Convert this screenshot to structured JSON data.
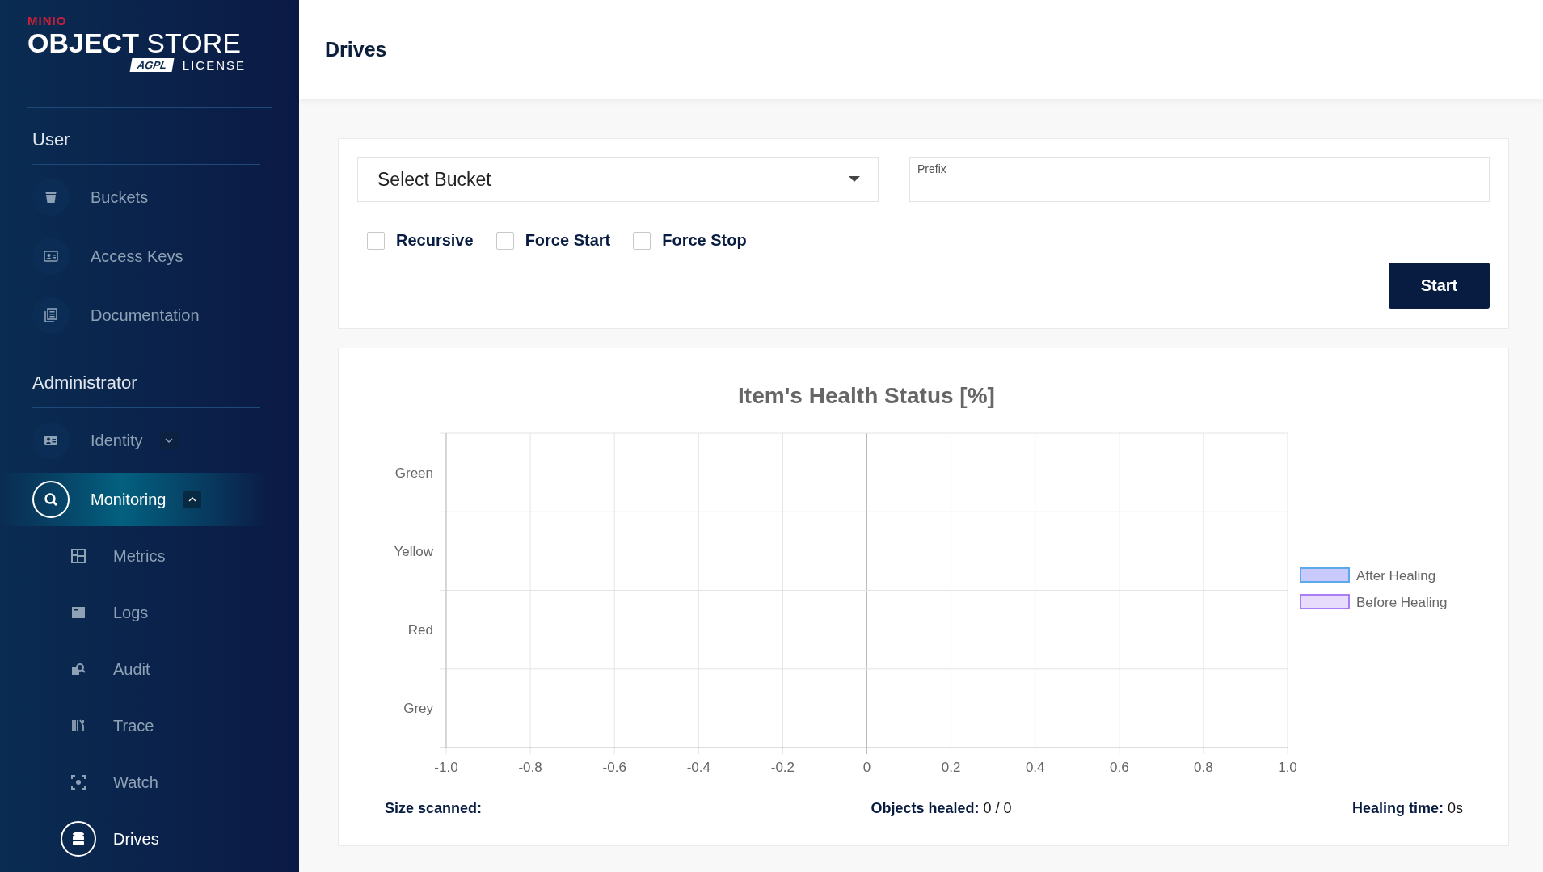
{
  "sidebar": {
    "logo": {
      "brand": "MINIO",
      "product_bold": "OBJECT",
      "product_light": "STORE",
      "badge": "AGPL",
      "license": "LICENSE"
    },
    "sections": [
      {
        "title": "User",
        "items": [
          {
            "label": "Buckets",
            "selected": false
          },
          {
            "label": "Access Keys",
            "selected": false
          },
          {
            "label": "Documentation",
            "selected": false
          }
        ]
      },
      {
        "title": "Administrator",
        "items": [
          {
            "label": "Identity",
            "selected": false,
            "expanded": false
          },
          {
            "label": "Monitoring",
            "selected": true,
            "expanded": true,
            "children": [
              {
                "label": "Metrics",
                "selected": false
              },
              {
                "label": "Logs",
                "selected": false
              },
              {
                "label": "Audit",
                "selected": false
              },
              {
                "label": "Trace",
                "selected": false
              },
              {
                "label": "Watch",
                "selected": false
              },
              {
                "label": "Drives",
                "selected": true
              }
            ]
          }
        ]
      }
    ]
  },
  "header": {
    "title": "Drives"
  },
  "form": {
    "bucket_select": {
      "value": "Select Bucket"
    },
    "prefix": {
      "label": "Prefix"
    },
    "options": [
      {
        "label": "Recursive",
        "checked": false
      },
      {
        "label": "Force Start",
        "checked": false
      },
      {
        "label": "Force Stop",
        "checked": false
      }
    ],
    "start_button": "Start"
  },
  "chart": {
    "chart_data": {
      "type": "bar",
      "orientation": "horizontal",
      "title": "Item's Health Status [%]",
      "categories": [
        "Green",
        "Yellow",
        "Red",
        "Grey"
      ],
      "series": [
        {
          "name": "After Healing",
          "color": "#5aa9e8",
          "values": [
            null,
            null,
            null,
            null
          ]
        },
        {
          "name": "Before Healing",
          "color": "#a97ef5",
          "values": [
            null,
            null,
            null,
            null
          ]
        }
      ],
      "grid": true,
      "xlim": [
        -1,
        1
      ],
      "xticks": [
        {
          "value": -1,
          "label": "-1.0"
        },
        {
          "value": -0.8,
          "label": "-0.8"
        },
        {
          "value": -0.6,
          "label": "-0.6"
        },
        {
          "value": -0.4,
          "label": "-0.4"
        },
        {
          "value": -0.2,
          "label": "-0.2"
        },
        {
          "value": 0,
          "label": "0"
        },
        {
          "value": 0.2,
          "label": "0.2"
        },
        {
          "value": 0.4,
          "label": "0.4"
        },
        {
          "value": 0.6,
          "label": "0.6"
        },
        {
          "value": 0.8,
          "label": "0.8"
        },
        {
          "value": 1,
          "label": "1.0"
        }
      ]
    }
  },
  "stats": [
    {
      "label": "Size scanned:"
    },
    {
      "label": "Objects healed:",
      "value": "0 / 0"
    },
    {
      "label": "Healing time:",
      "value": "0s"
    }
  ]
}
